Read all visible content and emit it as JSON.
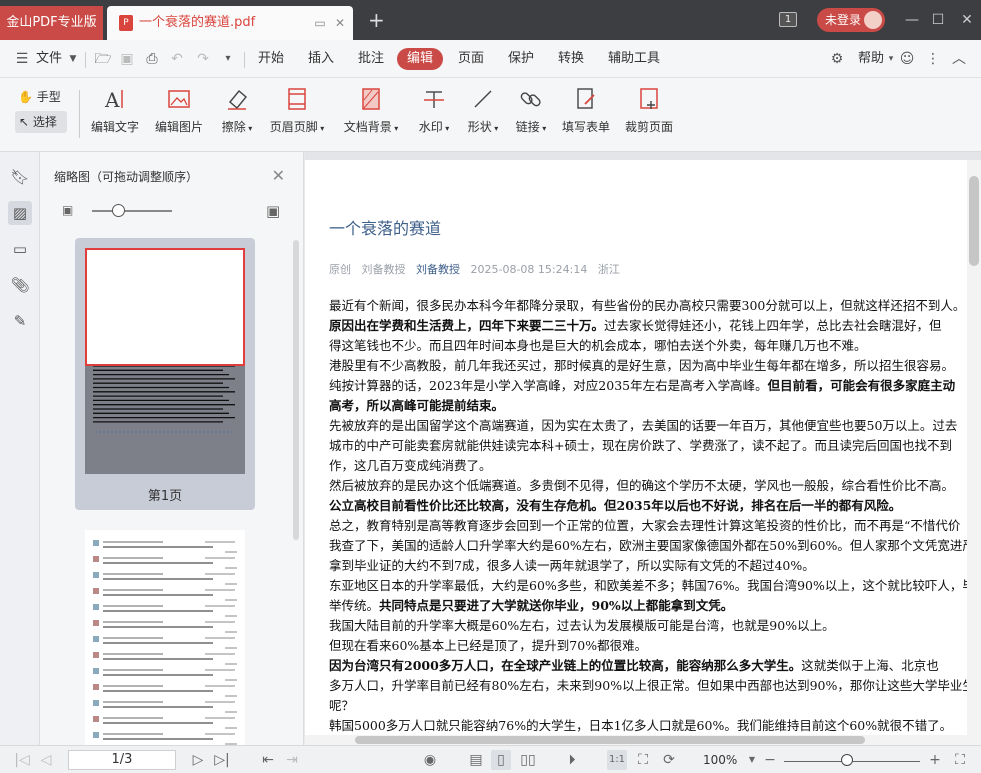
{
  "titlebar": {
    "app_name": "金山PDF专业版",
    "doc_tab_title": "一个衰落的赛道.pdf",
    "window_count": "1",
    "login_label": "未登录"
  },
  "menu": {
    "file": "文件",
    "tabs": [
      "开始",
      "插入",
      "批注",
      "编辑",
      "页面",
      "保护",
      "转换",
      "辅助工具"
    ],
    "active_tab": "编辑",
    "help": "帮助"
  },
  "ribbon": {
    "hand": "手型",
    "select": "选择",
    "tools": [
      "编辑文字",
      "编辑图片",
      "擦除",
      "页眉页脚",
      "文档背景",
      "水印",
      "形状",
      "链接",
      "填写表单",
      "裁剪页面"
    ]
  },
  "thumbnails": {
    "title": "缩略图（可拖动调整顺序）",
    "page1_label": "第1页"
  },
  "document": {
    "title": "一个衰落的赛道",
    "meta_original": "原创",
    "meta_author": "刘备教授",
    "meta_author_link": "刘备教授",
    "meta_datetime": "2025-08-08 15:24:14",
    "meta_location": "浙江",
    "lines": [
      {
        "n": "最近有个新闻，很多民办本科今年都降分录取，有些省份的民办高校只需要300分就可以上，但就这样还招不到人。",
        "b": ""
      },
      {
        "b": "原因出在学费和生活费上，四年下来要二三十万。",
        "n": "过去家长觉得娃还小，花钱上四年学，总比去社会瞎混好，但"
      },
      {
        "n": "得这笔钱也不少。而且四年时间本身也是巨大的机会成本，哪怕去送个外卖，每年赚几万也不难。",
        "b": ""
      },
      {
        "n": "港股里有不少高教股，前几年我还买过，那时候真的是好生意，因为高中毕业生每年都在增多，所以招生很容易。",
        "b": ""
      },
      {
        "n": "纯按计算器的话，2023年是小学入学高峰，对应2035年左右是高考入学高峰。",
        "b": "但目前看，可能会有很多家庭主动"
      },
      {
        "b": "高考，所以高峰可能提前结束。",
        "n": ""
      },
      {
        "n": "先被放弃的是出国留学这个高端赛道，因为实在太贵了，去美国的话要一年百万，其他便宜些也要50万以上。过去",
        "b": ""
      },
      {
        "n": "城市的中产可能卖套房就能供娃读完本科+硕士，现在房价跌了、学费涨了，读不起了。而且读完后回国也找不到",
        "b": ""
      },
      {
        "n": "作，这几百万变成纯消费了。",
        "b": ""
      },
      {
        "n": "然后被放弃的是民办这个低端赛道。多贵倒不见得，但的确这个学历不太硬，学风也一般般，综合看性价比不高。",
        "b": ""
      },
      {
        "b": "公立高校目前看性价比还比较高，没有生存危机。但2035年以后也不好说，排名在后一半的都有风险。",
        "n": ""
      },
      {
        "n": "总之，教育特别是高等教育逐步会回到一个正常的位置，大家会去理性计算这笔投资的性价比，而不再是“不惜代价",
        "b": ""
      },
      {
        "n": "我查了下，美国的适龄人口升学率大约是60%左右，欧洲主要国家像德国外都在50%到60%。但人家那个文凭宽进严出",
        "b": ""
      },
      {
        "n": "拿到毕业证的大约不到7成，很多人读一两年就退学了，所以实际有文凭的不超过40%。",
        "b": ""
      },
      {
        "n": "东亚地区日本的升学率最低，大约是60%多些，和欧美差不多；韩国76%。我国台湾90%以上，这个就比较吓人，毕",
        "b": ""
      },
      {
        "n": "举传统。",
        "b": "共同特点是只要进了大学就送你毕业，90%以上都能拿到文凭。"
      },
      {
        "n": "我国大陆目前的升学率大概是60%左右，过去认为发展模版可能是台湾，也就是90%以上。",
        "b": ""
      },
      {
        "n": "但现在看来60%基本上已经是顶了，提升到70%都很难。",
        "b": ""
      },
      {
        "b": "因为台湾只有2000多万人口，在全球产业链上的位置比较高，能容纳那么多大学生。",
        "n": "这就类似于上海、北京也"
      },
      {
        "n": "多万人口，升学率目前已经有80%左右，未来到90%以上很正常。但如果中西部也达到90%，那你让这些大学毕业生",
        "b": ""
      },
      {
        "n": "呢？",
        "b": ""
      },
      {
        "n": "韩国5000多万人口就只能容纳76%的大学生，日本1亿多人口就是60%。我们能维持目前这个60%就很不错了。",
        "b": ""
      }
    ]
  },
  "statusbar": {
    "page_indicator": "1/3",
    "zoom": "100%"
  }
}
